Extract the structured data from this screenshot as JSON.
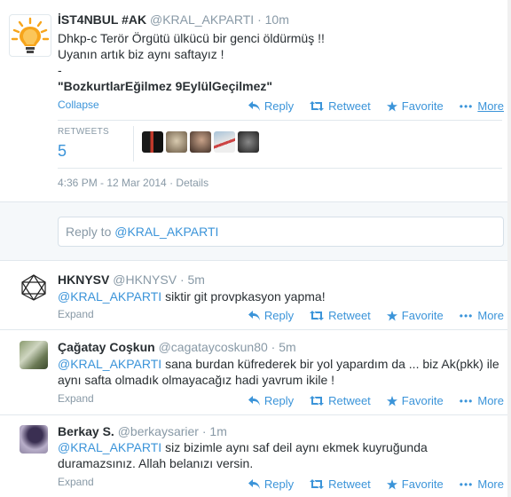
{
  "colors": {
    "link": "#3b94d9",
    "muted": "#8899a6",
    "text": "#292f33",
    "akp_orange": "#f7a51c"
  },
  "main_tweet": {
    "fullname": "İST4NBUL #AK",
    "handle": "@KRAL_AKPARTI",
    "sep": "·",
    "time": "10m",
    "line1": "Dhkp-c Terör Örgütü ülkücü bir genci öldürmüş !!",
    "line2": "Uyanın artık biz aynı saftayız !",
    "line3": "-",
    "line4": "\"BozkurtlarEğilmez 9EylülGeçilmez\"",
    "collapse": "Collapse",
    "stats_label": "RETWEETS",
    "stats_count": "5",
    "timestamp": "4:36 PM - 12 Mar 2014",
    "details_sep": "·",
    "details": "Details",
    "avatar_icon": "akp-lightbulb-logo"
  },
  "actions": {
    "reply": "Reply",
    "retweet": "Retweet",
    "favorite": "Favorite",
    "more": "More"
  },
  "reply_box": {
    "prefix": "Reply to ",
    "mention": "@KRAL_AKPARTI"
  },
  "replies": [
    {
      "fullname": "HKNYSV",
      "handle": "@HKNYSV",
      "sep": "·",
      "time": "5m",
      "mention": "@KRAL_AKPARTI",
      "text1": " siktir git provpkasyon yapma!",
      "text2": "",
      "expand": "Expand"
    },
    {
      "fullname": "Çağatay Coşkun",
      "handle": "@cagataycoskun80",
      "sep": "·",
      "time": "5m",
      "mention": "@KRAL_AKPARTI",
      "text1": " sana burdan küfrederek bir yol yapardım da ... biz Ak(pkk) ile",
      "text2": "aynı safta olmadık olmayacağız hadi yavrum ikile !",
      "expand": "Expand"
    },
    {
      "fullname": "Berkay S.",
      "handle": "@berkaysarier",
      "sep": "·",
      "time": "1m",
      "mention": "@KRAL_AKPARTI",
      "text1": " siz bizimle aynı saf deil aynı ekmek kuyruğunda",
      "text2": "duramazsınız. Allah belanızı versin.",
      "expand": "Expand"
    }
  ]
}
